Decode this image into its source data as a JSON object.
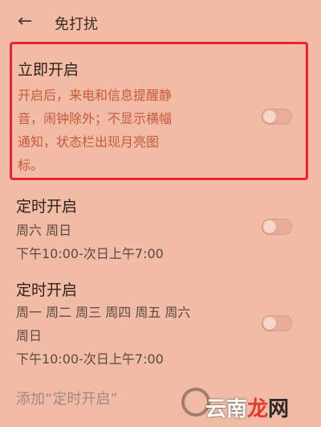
{
  "header": {
    "back_icon": "←",
    "title": "免打扰"
  },
  "immediate": {
    "title": "立即开启",
    "description_lines": [
      "开启后，来电和信息提醒静",
      "音，闹钟除外；不显示横幅",
      "通知，状态栏出现月亮图",
      "标。"
    ],
    "toggle_on": false
  },
  "schedules": [
    {
      "title": "定时开启",
      "days": "周六 周日",
      "time": "下午10:00-次日上午7:00",
      "toggle_on": false
    },
    {
      "title": "定时开启",
      "days_lines": [
        "周一 周二 周三 周四 周五 周六",
        "周日"
      ],
      "time": "下午10:00-次日上午7:00",
      "toggle_on": false
    }
  ],
  "add_schedule_label": "添加“定时开启”",
  "watermark": {
    "part1": "云南",
    "part2": "龙",
    "part3": "网"
  },
  "colors": {
    "background": "#f2bba5",
    "highlight_border": "#e8252a",
    "description_text": "#c85a3d"
  }
}
